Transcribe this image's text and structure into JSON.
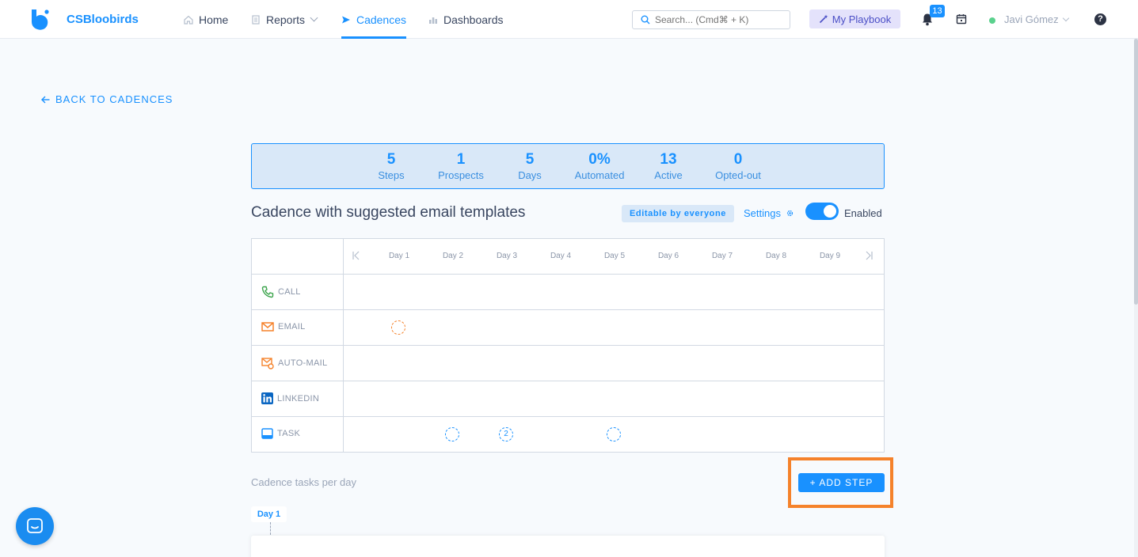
{
  "app": {
    "brand": "CSBloobirds",
    "nav": [
      {
        "label": "Home"
      },
      {
        "label": "Reports"
      },
      {
        "label": "Cadences"
      },
      {
        "label": "Dashboards"
      }
    ],
    "search_placeholder": "Search... (Cmd⌘ + K)",
    "playbook_label": "My Playbook",
    "notification_count": "13",
    "user_name": "Javi Gómez",
    "help_label": "?"
  },
  "back_link": "BACK TO CADENCES",
  "stats": [
    {
      "value": "5",
      "label": "Steps"
    },
    {
      "value": "1",
      "label": "Prospects"
    },
    {
      "value": "5",
      "label": "Days"
    },
    {
      "value": "0%",
      "label": "Automated"
    },
    {
      "value": "13",
      "label": "Active"
    },
    {
      "value": "0",
      "label": "Opted-out"
    }
  ],
  "cadence": {
    "title": "Cadence with suggested email templates",
    "editable_badge": "Editable by everyone",
    "settings_label": "Settings",
    "enabled": true,
    "enabled_label": "Enabled"
  },
  "grid": {
    "days": [
      "Day 1",
      "Day 2",
      "Day 3",
      "Day 4",
      "Day 5",
      "Day 6",
      "Day 7",
      "Day 8",
      "Day 9"
    ],
    "rows": [
      {
        "label": "CALL",
        "icon": "phone-icon",
        "color": "#3aa34a",
        "steps": []
      },
      {
        "label": "EMAIL",
        "icon": "envelope-icon",
        "color": "#f5822b",
        "steps": [
          {
            "day": 1,
            "count": ""
          }
        ]
      },
      {
        "label": "AUTO-MAIL",
        "icon": "auto-mail-icon",
        "color": "#f5822b",
        "steps": []
      },
      {
        "label": "LINKEDIN",
        "icon": "linkedin-icon",
        "color": "#0a66c2",
        "steps": []
      },
      {
        "label": "TASK",
        "icon": "task-icon",
        "color": "#1991ff",
        "steps": [
          {
            "day": 2,
            "count": ""
          },
          {
            "day": 3,
            "count": "2"
          },
          {
            "day": 5,
            "count": ""
          }
        ]
      }
    ]
  },
  "tasks_per_day_label": "Cadence tasks per day",
  "add_step_label": "+  ADD STEP",
  "timeline_day": "Day 1",
  "colors": {
    "accent": "#1991ff",
    "highlight": "#f5822b"
  }
}
